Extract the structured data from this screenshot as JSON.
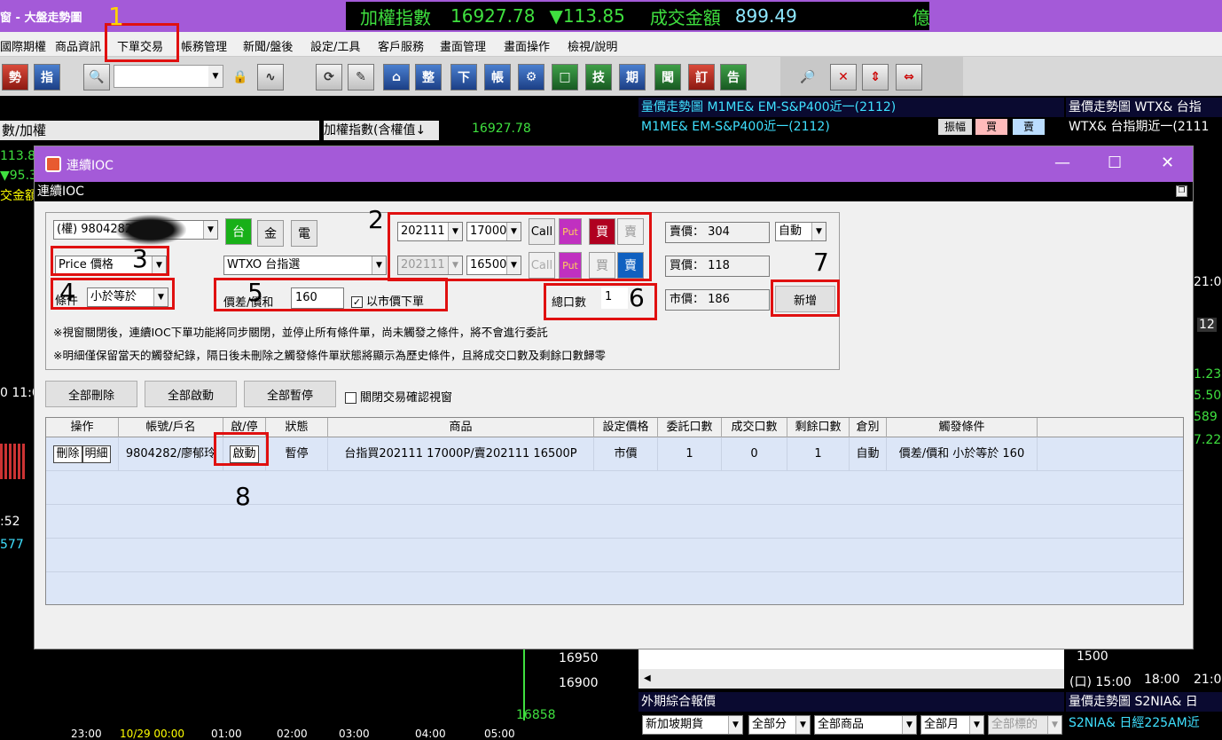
{
  "app": {
    "title": "窗 - 大盤走勢圖",
    "ticker": {
      "index_name": "加權指數",
      "index_value": "16927.78",
      "change": "▼113.85",
      "turnover_label": "成交金額",
      "turnover_value": "899.49",
      "unit": "億"
    }
  },
  "menubar": [
    "國際期權",
    "商品資訊",
    "下單交易",
    "帳務管理",
    "新聞/盤後",
    "設定/工具",
    "客戶服務",
    "畫面管理",
    "畫面操作",
    "檢視/說明"
  ],
  "toolbar": {
    "buttons": [
      "勢",
      "指",
      "整",
      "下",
      "帳",
      "技",
      "期",
      "聞",
      "訂",
      "告"
    ]
  },
  "background": {
    "left_header": "數/加權",
    "left_index_label": "加權指數(含權值↓",
    "left_index_value": "16927.78",
    "left_values": [
      "113.8",
      "▼95.3",
      "交金額"
    ],
    "right1_title": "量價走勢圖  M1ME&  EM-S&P400近一(2112)",
    "right1_sub": "M1ME&  EM-S&P400近一(2112)",
    "right1_buttons": [
      "振幅",
      "買",
      "賣"
    ],
    "right2_title": "量價走勢圖  WTX&  台指",
    "right2_sub": "WTX&  台指期近一(2111",
    "right_side_values": [
      "1.23",
      "5.50",
      "589",
      "7.22",
      "21:0",
      "12"
    ],
    "chart_prices": [
      "16950",
      "16900",
      "16858"
    ],
    "chart_times": [
      "23:00",
      "10/29 00:00",
      "01:00",
      "02:00",
      "03:00",
      "04:00",
      "05:00"
    ],
    "left_side_values": [
      "0 11:0",
      ":52",
      "577"
    ],
    "right2_axis": [
      "1500",
      "(口) 15:00",
      "18:00",
      "21:00"
    ],
    "bottom_panel_title": "外期綜合報價",
    "bottom_panel_selects": [
      "新加坡期貨",
      "全部分",
      "全部商品",
      "全部月",
      "全部標的"
    ],
    "bottom_right_title": "量價走勢圖  S2NIA&  日",
    "bottom_right_sub": "S2NIA&  日經225AM近"
  },
  "window": {
    "title": "連續IOC",
    "subbar": "連續IOC",
    "controls": {
      "min": "—",
      "max": "☐",
      "close": "✕"
    }
  },
  "form": {
    "account_select": "(權)  9804282 廖郁玲",
    "market_buttons": [
      "台",
      "金",
      "電"
    ],
    "price_type": "Price 價格",
    "product_select": "WTXO    台指選",
    "condition_label": "條件",
    "condition_select": "小於等於",
    "spread_label": "價差/價和",
    "spread_value": "160",
    "market_order_label": "以市價下單",
    "market_order_checked": "✓",
    "leg1": {
      "month": "202111",
      "strike": "17000",
      "call": "Call",
      "put": "Put",
      "buy": "買",
      "sell": "賣"
    },
    "leg2": {
      "month": "202111",
      "strike": "16500",
      "call": "Call",
      "put": "Put",
      "buy": "買",
      "sell": "賣"
    },
    "total_qty_label": "總口數",
    "total_qty_value": "1",
    "sell_price": "賣價： 304",
    "buy_price": "買價： 118",
    "market_price": "市價： 186",
    "auto_select": "自動",
    "add_button": "新增",
    "note1": "※視窗關閉後，連續IOC下單功能將同步關閉，並停止所有條件單，尚未觸發之條件，將不會進行委託",
    "note2": "※明細僅保留當天的觸發紀錄，隔日後未刪除之觸發條件單狀態將顯示為歷史條件，且將成交口數及剩餘口數歸零"
  },
  "actions": {
    "delete_all": "全部刪除",
    "start_all": "全部啟動",
    "pause_all": "全部暫停",
    "close_confirm": "關閉交易確認視窗"
  },
  "table": {
    "headers": [
      "操作",
      "帳號/戶名",
      "啟/停",
      "狀態",
      "商品",
      "設定價格",
      "委託口數",
      "成交口數",
      "剩餘口數",
      "倉別",
      "觸發條件"
    ],
    "row": {
      "delete": "刪除",
      "detail": "明細",
      "account": "9804282/廖郁玲",
      "toggle": "啟動",
      "status": "暫停",
      "product": "台指買202111 17000P/賣202111 16500P",
      "price": "市價",
      "order_qty": "1",
      "filled_qty": "0",
      "remaining_qty": "1",
      "position": "自動",
      "condition": "價差/價和 小於等於 160"
    }
  },
  "annotations": [
    "1",
    "2",
    "3",
    "4",
    "5",
    "6",
    "7",
    "8"
  ]
}
